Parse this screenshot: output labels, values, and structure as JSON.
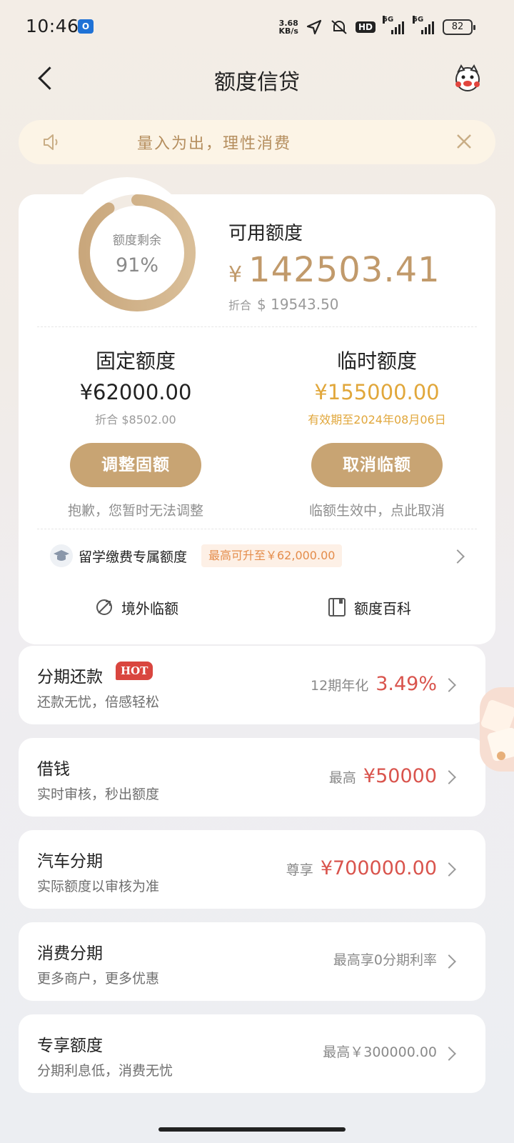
{
  "status_bar": {
    "time": "10:46",
    "net_speed_value": "3.68",
    "net_speed_unit": "KB/s",
    "hd_label": "HD",
    "signal1_label": "5G",
    "signal2_label": "5G",
    "battery": "82"
  },
  "nav": {
    "title": "额度信贷"
  },
  "notice": {
    "text": "量入为出，理性消费"
  },
  "credit": {
    "ring_label": "额度剩余",
    "ring_percent": "91%",
    "ring_fraction": 0.91,
    "available_label": "可用额度",
    "available_currency": "¥",
    "available_amount": "142503.41",
    "converted_prefix": "折合",
    "converted_amount": "$ 19543.50",
    "accent_color": "#c19a6b"
  },
  "fixed": {
    "title": "固定额度",
    "amount": "¥62000.00",
    "converted": "折合 $8502.00",
    "button": "调整固额",
    "note": "抱歉，您暂时无法调整"
  },
  "temp": {
    "title": "临时额度",
    "amount": "¥155000.00",
    "validity": "有效期至2024年08月06日",
    "button": "取消临额",
    "note": "临额生效中，点此取消"
  },
  "study": {
    "label": "留学缴费专属额度",
    "tag": "最高可升至￥62,000.00"
  },
  "tools": [
    {
      "label": "境外临额",
      "icon": "overseas-credit-icon"
    },
    {
      "label": "额度百科",
      "icon": "book-icon"
    }
  ],
  "items": [
    {
      "title": "分期还款",
      "badge": "HOT",
      "sub": "还款无忧，倍感轻松",
      "right_prefix": "12期年化",
      "right_value": "3.49%"
    },
    {
      "title": "借钱",
      "sub": "实时审核，秒出额度",
      "right_prefix": "最高",
      "right_value": "¥50000"
    },
    {
      "title": "汽车分期",
      "sub": "实际额度以审核为准",
      "right_prefix": "尊享",
      "right_value": "¥700000.00"
    },
    {
      "title": "消费分期",
      "sub": "更多商户，更多优惠",
      "right_prefix": "最高享0分期利率",
      "right_value": ""
    },
    {
      "title": "专享额度",
      "sub": "分期利息低，消费无忧",
      "right_prefix": "最高￥300000.00",
      "right_value": ""
    }
  ]
}
